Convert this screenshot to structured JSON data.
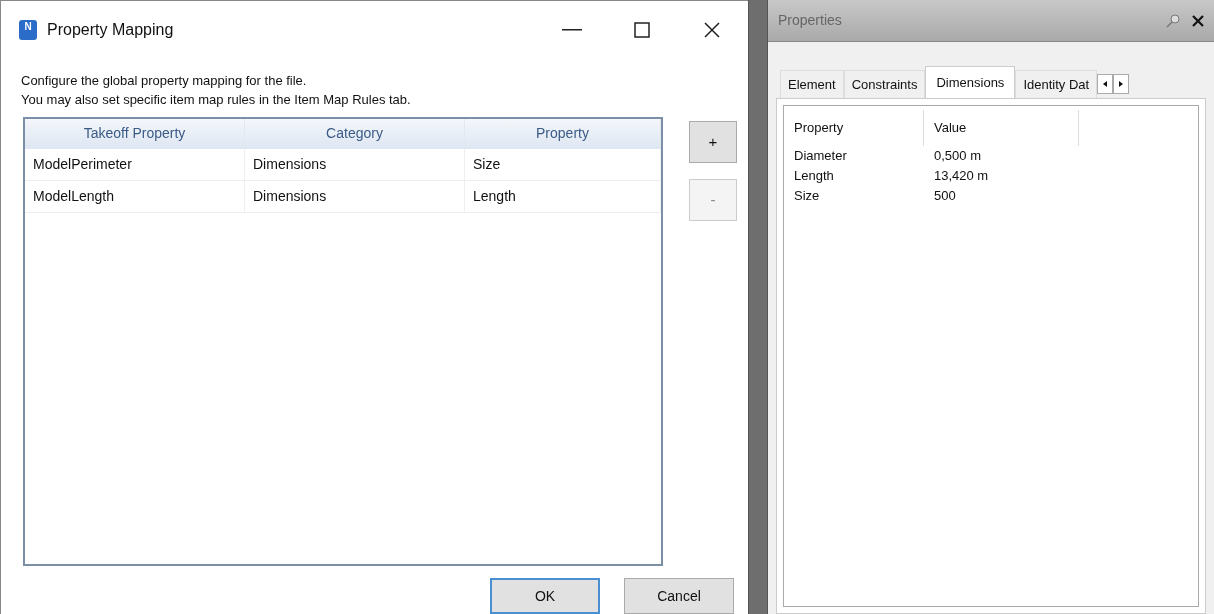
{
  "dialog": {
    "title": "Property Mapping",
    "app_icon_letter": "N",
    "intro": [
      "Configure the global property mapping for the file.",
      "You may also set specific item map rules in the Item Map Rules tab."
    ],
    "table": {
      "columns": [
        "Takeoff Property",
        "Category",
        "Property"
      ],
      "rows": [
        [
          "ModelPerimeter",
          "Dimensions",
          "Size"
        ],
        [
          "ModelLength",
          "Dimensions",
          "Length"
        ]
      ]
    },
    "side_buttons": [
      {
        "label": "+",
        "disabled": false
      },
      {
        "label": "-",
        "disabled": true
      }
    ],
    "buttons": [
      {
        "label": "OK",
        "selected": true
      },
      {
        "label": "Cancel",
        "selected": false
      }
    ]
  },
  "properties_panel": {
    "title": "Properties",
    "tabs": [
      {
        "label": "Element",
        "selected": false
      },
      {
        "label": "Constraints",
        "selected": false
      },
      {
        "label": "Dimensions",
        "selected": true
      },
      {
        "label": "Identity Dat",
        "selected": false
      }
    ],
    "columns": [
      "Property",
      "Value"
    ],
    "rows": [
      [
        "Diameter",
        "0,500 m"
      ],
      [
        "Length",
        "13,420 m"
      ],
      [
        "Size",
        "500"
      ]
    ]
  }
}
